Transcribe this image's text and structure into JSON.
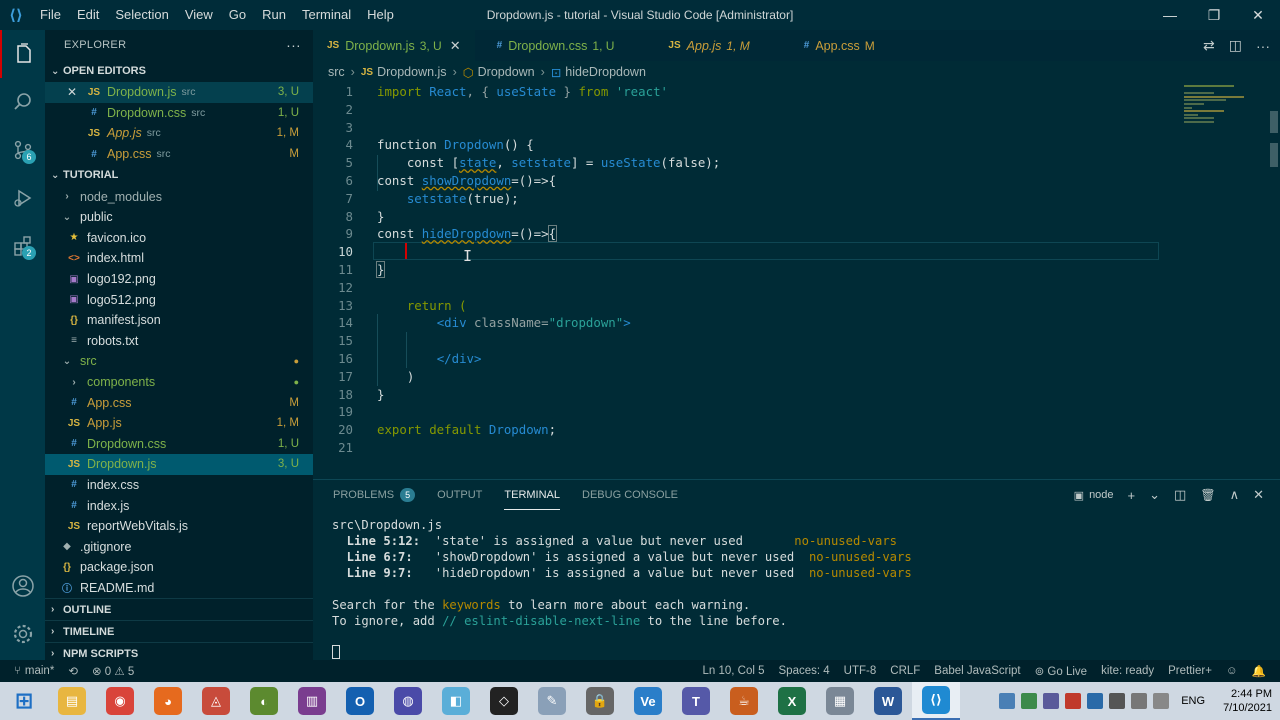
{
  "titlebar": {
    "logo": "⟨⟩",
    "menu": [
      "File",
      "Edit",
      "Selection",
      "View",
      "Go",
      "Run",
      "Terminal",
      "Help"
    ],
    "title": "Dropdown.js - tutorial - Visual Studio Code [Administrator]",
    "controls": [
      "—",
      "❐",
      "✕"
    ]
  },
  "activity_bar": {
    "icons": [
      "files-icon",
      "search-icon",
      "source-control-icon",
      "run-debug-icon",
      "extensions-icon",
      "account-icon",
      "settings-gear-icon"
    ],
    "badges": {
      "source_control": "6",
      "extensions": "2"
    }
  },
  "sidebar": {
    "title": "EXPLORER",
    "more": "···",
    "open_editors": {
      "label": "OPEN EDITORS",
      "items": [
        {
          "icon": "JS",
          "name": "Dropdown.js",
          "dir": "src",
          "status": "3, U",
          "close": "✕"
        },
        {
          "icon": "#",
          "name": "Dropdown.css",
          "dir": "src",
          "status": "1, U"
        },
        {
          "icon": "JS",
          "name": "App.js",
          "dir": "src",
          "status": "1, M"
        },
        {
          "icon": "#",
          "name": "App.css",
          "dir": "src",
          "status": "M"
        }
      ]
    },
    "project": {
      "label": "TUTORIAL",
      "items": [
        {
          "icon": "›",
          "name": "node_modules",
          "status": ""
        },
        {
          "icon": "⌄",
          "name": "public",
          "status": ""
        },
        {
          "icon": "★",
          "name": "favicon.ico",
          "status": ""
        },
        {
          "icon": "<>",
          "name": "index.html",
          "status": ""
        },
        {
          "icon": "▣",
          "name": "logo192.png",
          "status": ""
        },
        {
          "icon": "▣",
          "name": "logo512.png",
          "status": ""
        },
        {
          "icon": "{}",
          "name": "manifest.json",
          "status": ""
        },
        {
          "icon": "≡",
          "name": "robots.txt",
          "status": ""
        },
        {
          "icon": "⌄",
          "name": "src",
          "status": "●"
        },
        {
          "icon": "›",
          "name": "components",
          "status": "●"
        },
        {
          "icon": "#",
          "name": "App.css",
          "status": "M"
        },
        {
          "icon": "JS",
          "name": "App.js",
          "status": "1, M"
        },
        {
          "icon": "#",
          "name": "Dropdown.css",
          "status": "1, U"
        },
        {
          "icon": "JS",
          "name": "Dropdown.js",
          "status": "3, U"
        },
        {
          "icon": "#",
          "name": "index.css",
          "status": ""
        },
        {
          "icon": "#",
          "name": "index.js",
          "status": ""
        },
        {
          "icon": "JS",
          "name": "reportWebVitals.js",
          "status": ""
        },
        {
          "icon": "◆",
          "name": ".gitignore",
          "status": ""
        },
        {
          "icon": "{}",
          "name": "package.json",
          "status": ""
        },
        {
          "icon": "ⓘ",
          "name": "README.md",
          "status": ""
        }
      ]
    },
    "outline": "OUTLINE",
    "timeline": "TIMELINE",
    "npm": "NPM SCRIPTS"
  },
  "tabs": [
    {
      "icon": "JS",
      "name": "Dropdown.js",
      "status": "3, U",
      "close": "✕"
    },
    {
      "icon": "#",
      "name": "Dropdown.css",
      "status": "1, U"
    },
    {
      "icon": "JS",
      "name": "App.js",
      "status": "1, M"
    },
    {
      "icon": "#",
      "name": "App.css",
      "status": "M"
    }
  ],
  "tab_actions": [
    "⇄",
    "◫",
    "···"
  ],
  "breadcrumb": {
    "folder": "src",
    "file_icon": "JS",
    "file": "Dropdown.js",
    "component_icon": "⬡",
    "component": "Dropdown",
    "function_icon": "⊡",
    "function": "hideDropdown",
    "sep": "›"
  },
  "editor": {
    "line_numbers": [
      "1",
      "2",
      "3",
      "4",
      "5",
      "6",
      "7",
      "8",
      "9",
      "10",
      "11",
      "12",
      "13",
      "14",
      "15",
      "16",
      "17",
      "18",
      "19",
      "20",
      "21"
    ],
    "current_line": "10",
    "code": {
      "l1": {
        "a": "import ",
        "b": "React",
        "c": ", { ",
        "d": "useState",
        "e": " } ",
        "f": "from ",
        "g": "'react'"
      },
      "l4": {
        "a": "function ",
        "b": "Dropdown",
        "c": "() {"
      },
      "l5": {
        "a": "    const [",
        "b": "state",
        "c": ", ",
        "d": "setstate",
        "e": "] = ",
        "f": "useState",
        "g": "(false);"
      },
      "l6": {
        "a": "const ",
        "b": "showDropdown",
        "c": "=()=>{"
      },
      "l7": {
        "a": "    ",
        "b": "setstate",
        "c": "(true);"
      },
      "l8": {
        "a": "}"
      },
      "l9": {
        "a": "const ",
        "b": "hideDropdown",
        "c": "=()=>",
        "d": "{"
      },
      "l11": {
        "a": "}"
      },
      "l13": {
        "a": "    return ("
      },
      "l14": {
        "a": "        ",
        "b": "<div ",
        "c": "className=",
        "d": "\"dropdown\"",
        "e": ">"
      },
      "l16": {
        "a": "        ",
        "b": "</div>"
      },
      "l17": {
        "a": "    )"
      },
      "l18": {
        "a": "}"
      },
      "l20": {
        "a": "export ",
        "b": "default ",
        "c": "Dropdown",
        "d": ";"
      }
    }
  },
  "panel": {
    "tabs": [
      "PROBLEMS",
      "OUTPUT",
      "TERMINAL",
      "DEBUG CONSOLE"
    ],
    "problems_count": "5",
    "actions": {
      "shell": "node",
      "add": "+",
      "dropdown": "⌄",
      "split": "◫",
      "kill": "🗑",
      "max": "∧",
      "close": "✕",
      "shell_icon": "▣"
    },
    "terminal": {
      "file": "src\\Dropdown.js",
      "warnings": [
        {
          "loc": "  Line 5:12:",
          "msg": "  'state' is assigned a value but never used       ",
          "rule": "no-unused-vars"
        },
        {
          "loc": "  Line 6:7:",
          "msg": "   'showDropdown' is assigned a value but never used  ",
          "rule": "no-unused-vars"
        },
        {
          "loc": "  Line 9:7:",
          "msg": "   'hideDropdown' is assigned a value but never used  ",
          "rule": "no-unused-vars"
        }
      ],
      "search_a": "Search for the ",
      "search_kw": "keywords",
      "search_b": " to learn more about each warning.",
      "ignore_a": "To ignore, add ",
      "ignore_cm": "// eslint-disable-next-line",
      "ignore_b": " to the line before."
    }
  },
  "status": {
    "branch": "main*",
    "sync": "⟲",
    "problems": "⊗ 0 ⚠ 5",
    "position": "Ln 10, Col 5",
    "spaces": "Spaces: 4",
    "encoding": "UTF-8",
    "eol": "CRLF",
    "language": "Babel JavaScript",
    "golive": "⊚ Go Live",
    "kite": "kite: ready",
    "prettier": "Prettier+",
    "feedback": "☺",
    "bell": "🔔"
  },
  "taskbar": {
    "apps": [
      {
        "name": "start",
        "glyph": "⊞",
        "color": "#1e6fc4"
      },
      {
        "name": "explorer",
        "glyph": "▤",
        "color": "#e8b640"
      },
      {
        "name": "chrome",
        "glyph": "◉",
        "color": "#d9443a"
      },
      {
        "name": "firefox",
        "glyph": "◕",
        "color": "#e66a1e"
      },
      {
        "name": "app-red",
        "glyph": "◬",
        "color": "#c84b3b"
      },
      {
        "name": "app-frog",
        "glyph": "◐",
        "color": "#5c8a2f"
      },
      {
        "name": "winrar",
        "glyph": "▥",
        "color": "#7a3d8f"
      },
      {
        "name": "outlook",
        "glyph": "O",
        "color": "#1460b0"
      },
      {
        "name": "app-sphere",
        "glyph": "◍",
        "color": "#4a4aa8"
      },
      {
        "name": "notes",
        "glyph": "◧",
        "color": "#5aaed8"
      },
      {
        "name": "unity",
        "glyph": "◇",
        "color": "#222222"
      },
      {
        "name": "paint",
        "glyph": "✎",
        "color": "#8aa0b8"
      },
      {
        "name": "lock",
        "glyph": "🔒",
        "color": "#666666"
      },
      {
        "name": "ve",
        "glyph": "Ve",
        "color": "#2a7ec9"
      },
      {
        "name": "teams",
        "glyph": "T",
        "color": "#5559a8"
      },
      {
        "name": "java",
        "glyph": "☕",
        "color": "#c95e1e"
      },
      {
        "name": "excel",
        "glyph": "X",
        "color": "#1e7145"
      },
      {
        "name": "calculator",
        "glyph": "▦",
        "color": "#7a8796"
      },
      {
        "name": "word",
        "glyph": "W",
        "color": "#2b5797"
      },
      {
        "name": "vscode",
        "glyph": "⟨⟩",
        "color": "#1f8ad2"
      }
    ],
    "lang": "ENG",
    "time": "2:44 PM",
    "date": "7/10/2021"
  }
}
